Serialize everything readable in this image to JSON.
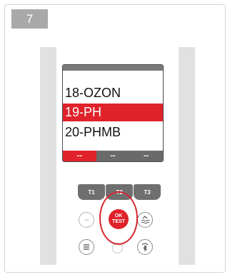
{
  "step": {
    "number": "7"
  },
  "screen": {
    "menu_items": [
      "18-OZON",
      "19-PH",
      "20-PHMB"
    ],
    "selected_index": 1,
    "softkeys": [
      "--",
      "--",
      "--"
    ],
    "active_softkey_index": 0
  },
  "buttons": {
    "t1": "T1",
    "t2": "T2",
    "t3": "T3",
    "ok_line1": "OK",
    "ok_line2": "TEST"
  },
  "colors": {
    "accent_red": "#e0222a",
    "badge_gray": "#a9a9a9",
    "button_gray": "#6f6f6f"
  },
  "icons": {
    "right_mid": "water-level-icon",
    "left_bottom": "menu-icon",
    "right_bottom": "bluetooth-icon"
  }
}
